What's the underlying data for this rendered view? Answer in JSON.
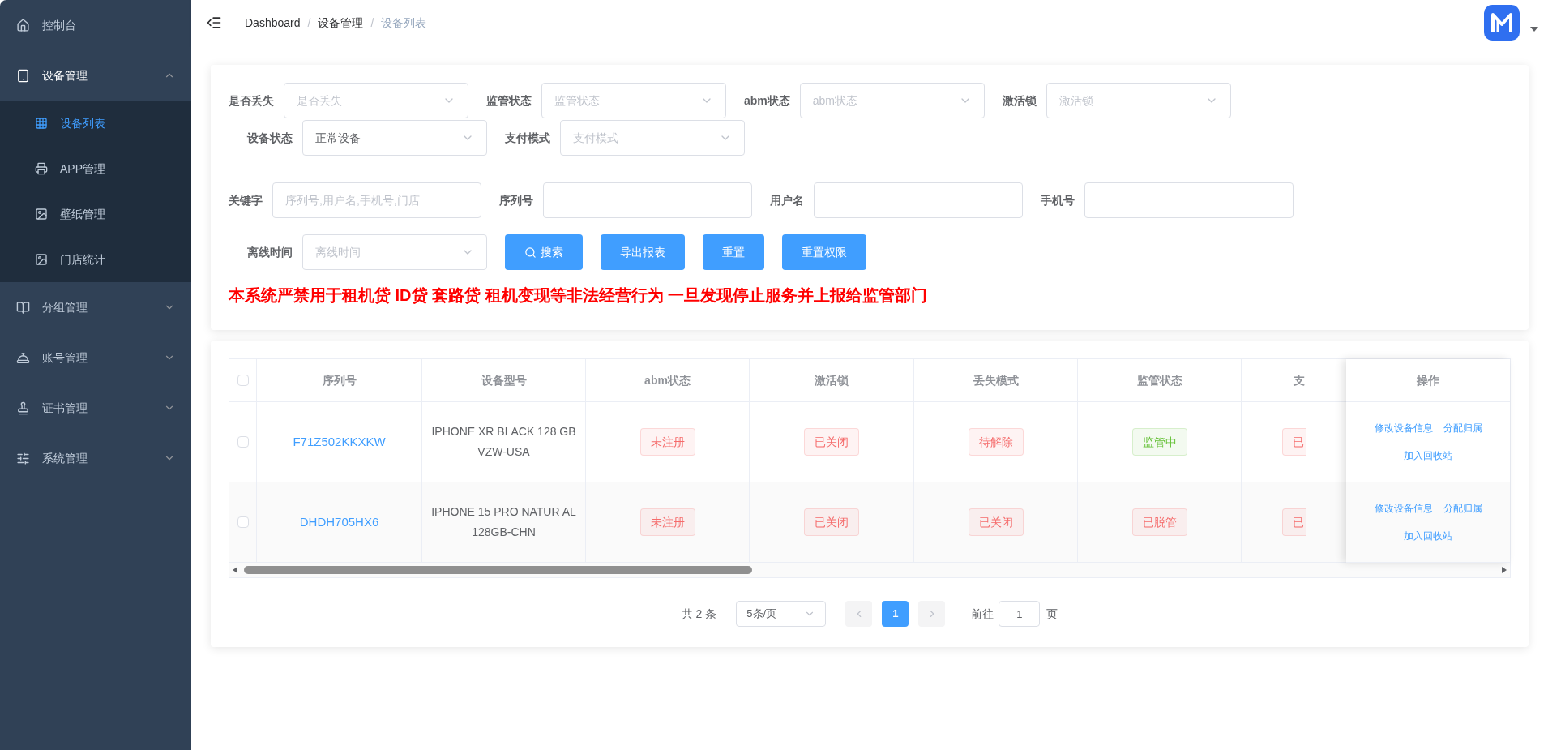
{
  "sidebar": {
    "items": [
      {
        "kind": "link",
        "label": "控制台",
        "selected": false
      },
      {
        "kind": "group",
        "label": "设备管理",
        "expanded": true,
        "children": [
          {
            "label": "设备列表",
            "selected": true
          },
          {
            "label": "APP管理",
            "selected": false
          },
          {
            "label": "壁纸管理",
            "selected": false
          },
          {
            "label": "门店统计",
            "selected": false
          }
        ]
      },
      {
        "kind": "group",
        "label": "分组管理",
        "expanded": false
      },
      {
        "kind": "group",
        "label": "账号管理",
        "expanded": false
      },
      {
        "kind": "group",
        "label": "证书管理",
        "expanded": false
      },
      {
        "kind": "group",
        "label": "系统管理",
        "expanded": false
      }
    ]
  },
  "breadcrumb": {
    "separator": "/",
    "items": [
      "Dashboard",
      "设备管理",
      "设备列表"
    ]
  },
  "filters": {
    "rows": [
      {
        "fields": [
          {
            "kind": "select",
            "label": "是否丢失",
            "placeholder": "是否丢失"
          },
          {
            "kind": "select",
            "label": "监管状态",
            "placeholder": "监管状态"
          },
          {
            "kind": "select",
            "label": "abm状态",
            "placeholder": "abm状态"
          },
          {
            "kind": "select",
            "label": "激活锁",
            "placeholder": "激活锁"
          }
        ]
      },
      {
        "fields": [
          {
            "kind": "select",
            "label": "设备状态",
            "value": "正常设备"
          },
          {
            "kind": "select",
            "label": "支付模式",
            "placeholder": "支付模式"
          }
        ]
      },
      {
        "fields": [
          {
            "kind": "input",
            "label": "关键字",
            "placeholder": "序列号,用户名,手机号,门店"
          },
          {
            "kind": "input",
            "label": "序列号"
          },
          {
            "kind": "input",
            "label": "用户名"
          },
          {
            "kind": "input",
            "label": "手机号"
          }
        ]
      },
      {
        "fields": [
          {
            "kind": "select",
            "label": "离线时间",
            "placeholder": "离线时间"
          }
        ]
      }
    ],
    "buttons": [
      {
        "label": "搜索",
        "kind": "search"
      },
      {
        "label": "导出报表",
        "kind": "plain"
      },
      {
        "label": "重置",
        "kind": "plain"
      },
      {
        "label": "重置权限",
        "kind": "plain"
      }
    ],
    "warning": "本系统严禁用于租机贷 ID贷 套路贷 租机变现等非法经营行为 一旦发现停止服务并上报给监管部门"
  },
  "table": {
    "all_checked": false,
    "columns": [
      "序列号",
      "设备型号",
      "abm状态",
      "激活锁",
      "丢失模式",
      "监管状态",
      "支"
    ],
    "action_column": "操作",
    "rows": [
      {
        "checked": false,
        "serial": "F71Z502KKXKW",
        "model": "IPHONE XR BLACK 128 GB VZW-USA",
        "tags": [
          {
            "text": "未注册",
            "color": "#f56c6c"
          },
          {
            "text": "已关闭",
            "color": "#f56c6c"
          },
          {
            "text": "待解除",
            "color": "#f56c6c"
          },
          {
            "text": "监管中",
            "color": "#67c23a"
          },
          {
            "text": "已",
            "color": "#f56c6c"
          }
        ],
        "actions": [
          "修改设备信息",
          "分配归属",
          "加入回收站"
        ]
      },
      {
        "checked": false,
        "serial": "DHDH705HX6",
        "model": "IPHONE 15 PRO NATUR AL 128GB-CHN",
        "tags": [
          {
            "text": "未注册",
            "color": "#f56c6c"
          },
          {
            "text": "已关闭",
            "color": "#f56c6c"
          },
          {
            "text": "已关闭",
            "color": "#f56c6c"
          },
          {
            "text": "已脱管",
            "color": "#f56c6c"
          },
          {
            "text": "已",
            "color": "#f56c6c"
          }
        ],
        "actions": [
          "修改设备信息",
          "分配归属",
          "加入回收站"
        ]
      }
    ]
  },
  "pagination": {
    "total": "共 2 条",
    "page_size": "5条/页",
    "pages": [
      {
        "label": "1",
        "selected": true
      }
    ],
    "goto_label": "前往",
    "goto_value": "1",
    "goto_suffix": "页"
  }
}
